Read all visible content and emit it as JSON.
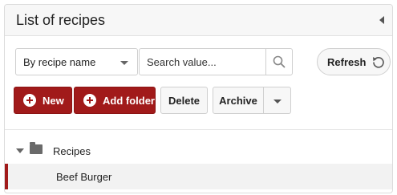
{
  "header": {
    "title": "List of recipes"
  },
  "filter": {
    "mode": "By recipe name",
    "search_placeholder": "Search value...",
    "refresh_label": "Refresh"
  },
  "toolbar": {
    "new_label": "New",
    "add_folder_label": "Add folder",
    "delete_label": "Delete",
    "archive_label": "Archive"
  },
  "tree": {
    "folder_label": "Recipes",
    "items": [
      {
        "label": "Beef Burger",
        "selected": true
      }
    ]
  },
  "colors": {
    "accent": "#a11a1a",
    "header_bg": "#f7f7f7",
    "selected_bg": "#f2f2f2"
  },
  "icons": [
    "collapse-arrow-icon",
    "chevron-down-icon",
    "search-icon",
    "refresh-icon",
    "plus-circle-icon",
    "folder-icon",
    "tree-expand-icon"
  ]
}
